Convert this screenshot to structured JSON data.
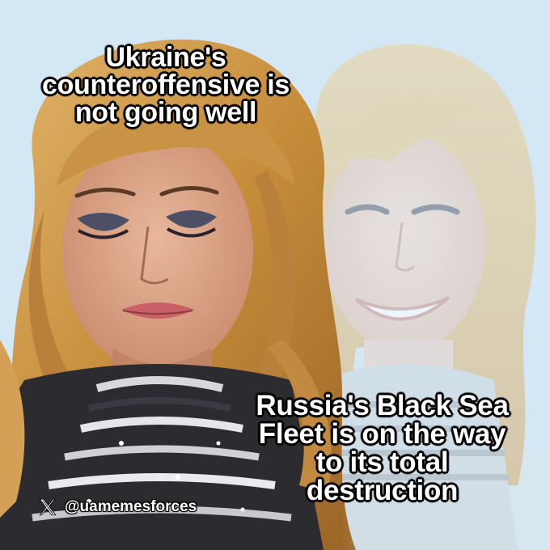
{
  "meme": {
    "top_caption": "Ukraine's counteroffensive is not going well",
    "bottom_caption": "Russia's Black Sea Fleet is on the way to its total destruction",
    "watermark": {
      "icon": "x-logo-icon",
      "handle": "@uamemesforces"
    }
  },
  "colors": {
    "background": "#cfe6f3",
    "hair": "#c9923f",
    "caption_text": "#ffffff",
    "caption_outline": "#000000"
  }
}
